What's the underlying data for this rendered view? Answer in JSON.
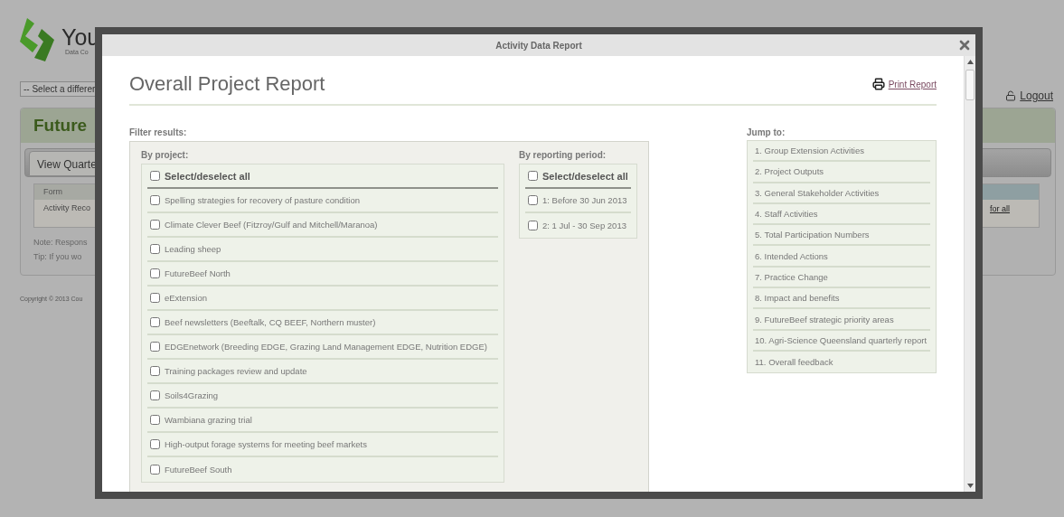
{
  "background": {
    "logo": {
      "text": "You",
      "subtitle": "Data Co"
    },
    "project_select": {
      "value": "-- Select a differer"
    },
    "logout": "Logout",
    "panel": {
      "title": "Future",
      "tabs": [
        {
          "label": "View Quarte",
          "selected": true
        }
      ],
      "table": {
        "columns": [
          "Form"
        ],
        "rows": [
          {
            "cells": [
              "Activity Reco"
            ],
            "link": "for all"
          }
        ]
      },
      "notes": [
        "Note: Respons",
        "Tip: If you wo"
      ]
    },
    "copyright": "Copyright © 2013 Cou"
  },
  "dialog": {
    "title": "Activity Data Report",
    "heading": "Overall Project Report",
    "print_link": "Print Report",
    "filter": {
      "label": "Filter results:",
      "by_project": {
        "label": "By project:",
        "select_all": {
          "label": "Select/deselect all",
          "checked": false
        },
        "items": [
          {
            "label": "Spelling strategies for recovery of pasture condition",
            "checked": false
          },
          {
            "label": "Climate Clever Beef (Fitzroy/Gulf and Mitchell/Maranoa)",
            "checked": false
          },
          {
            "label": "Leading sheep",
            "checked": false
          },
          {
            "label": "FutureBeef North",
            "checked": false
          },
          {
            "label": "eExtension",
            "checked": false
          },
          {
            "label": "Beef newsletters (Beeftalk, CQ BEEF, Northern muster)",
            "checked": false
          },
          {
            "label": "EDGEnetwork (Breeding EDGE, Grazing Land Management EDGE, Nutrition EDGE)",
            "checked": false
          },
          {
            "label": "Training packages review and update",
            "checked": false
          },
          {
            "label": "Soils4Grazing",
            "checked": false
          },
          {
            "label": "Wambiana grazing trial",
            "checked": false
          },
          {
            "label": "High-output forage systems for meeting beef markets",
            "checked": false
          },
          {
            "label": "FutureBeef South",
            "checked": false
          }
        ]
      },
      "by_period": {
        "label": "By reporting period:",
        "select_all": {
          "label": "Select/deselect all",
          "checked": false
        },
        "items": [
          {
            "label": "1: Before 30 Jun 2013",
            "checked": false
          },
          {
            "label": "2: 1 Jul - 30 Sep 2013",
            "checked": false
          }
        ]
      }
    },
    "jump_to": {
      "label": "Jump to:",
      "items": [
        "1. Group Extension Activities",
        "2. Project Outputs",
        "3. General Stakeholder Activities",
        "4. Staff Activities",
        "5. Total Participation Numbers",
        "6. Intended Actions",
        "7. Practice Change",
        "8. Impact and benefits",
        "9. FutureBeef strategic priority areas",
        "10. Agri-Science Queensland quarterly report",
        "11. Overall feedback"
      ]
    }
  }
}
